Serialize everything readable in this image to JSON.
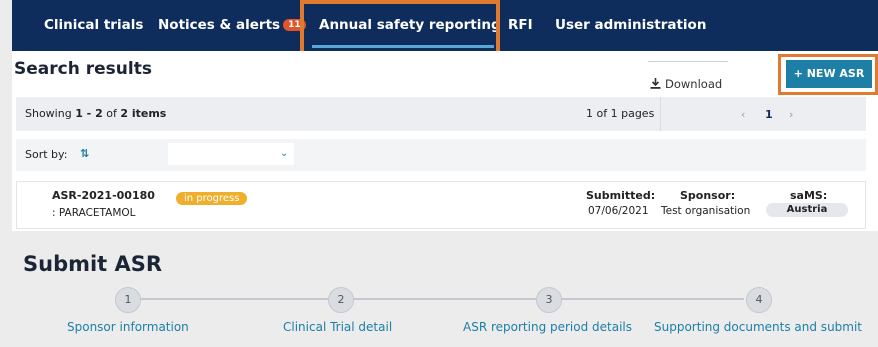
{
  "nav": {
    "items": [
      "Clinical trials",
      "Notices & alerts",
      "Annual safety reporting",
      "RFI",
      "User administration"
    ],
    "alerts_count": "11",
    "active": "Annual safety reporting"
  },
  "search": {
    "title": "Search results",
    "download_label": "Download",
    "new_asr_label": "+ NEW ASR",
    "showing_prefix": "Showing ",
    "showing_range": "1 - 2",
    "showing_mid": " of ",
    "showing_total": "2 items",
    "pages_text": "1 of 1 pages",
    "prev": "‹",
    "current_page": "1",
    "next": "›",
    "sort_label": "Sort by:",
    "sort_icon": "⇅"
  },
  "result": {
    "id": "ASR-2021-00180",
    "product": ": PARACETAMOL",
    "status": "in progress",
    "submitted_label": "Submitted:",
    "submitted_value": "07/06/2021",
    "sponsor_label": "Sponsor:",
    "sponsor_value": "Test organisation",
    "sams_label": "saMS:",
    "sams_value": "Austria"
  },
  "submit": {
    "title": "Submit ASR",
    "steps": [
      {
        "number": "1",
        "label": "Sponsor information"
      },
      {
        "number": "2",
        "label": "Clinical Trial detail"
      },
      {
        "number": "3",
        "label": "ASR reporting period details"
      },
      {
        "number": "4",
        "label": "Supporting documents and submit"
      }
    ]
  },
  "colors": {
    "nav_bg": "#0e2d5c",
    "accent": "#1d7fa6",
    "highlight": "#e07a30",
    "status": "#f0ae2d",
    "badge": "#e2552b"
  }
}
